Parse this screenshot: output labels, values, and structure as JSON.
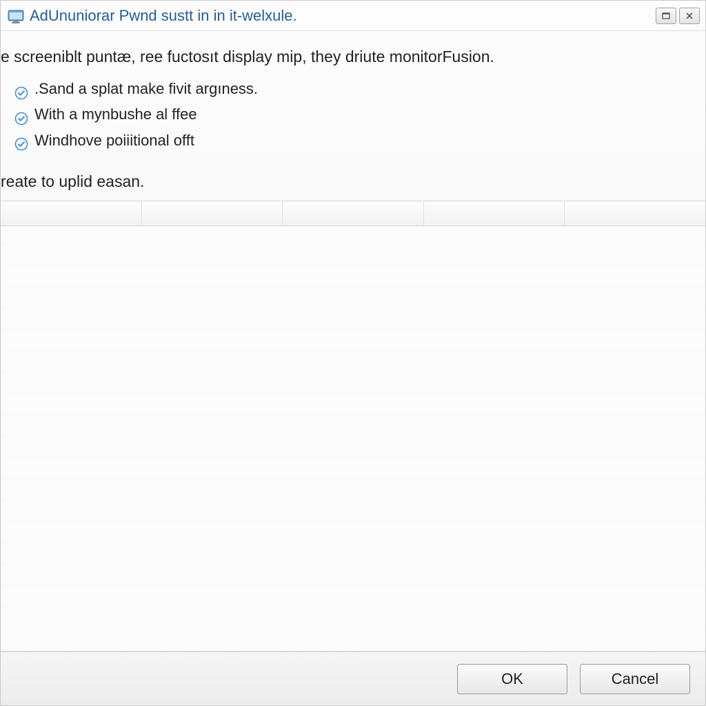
{
  "title": "AdUnuniorar Pwnd sustt in in it-welxule.",
  "heading": "e screeniblt puntæ, ree fuctosıt display mip, they driute monitorFusion.",
  "bullets": [
    ".Sand a splat make fivit argıness.",
    "With a mynbushe al ffee",
    "Windhove poiiitional offt"
  ],
  "sub_heading": "reate to uplid easan.",
  "buttons": {
    "ok": "OK",
    "cancel": "Cancel"
  }
}
